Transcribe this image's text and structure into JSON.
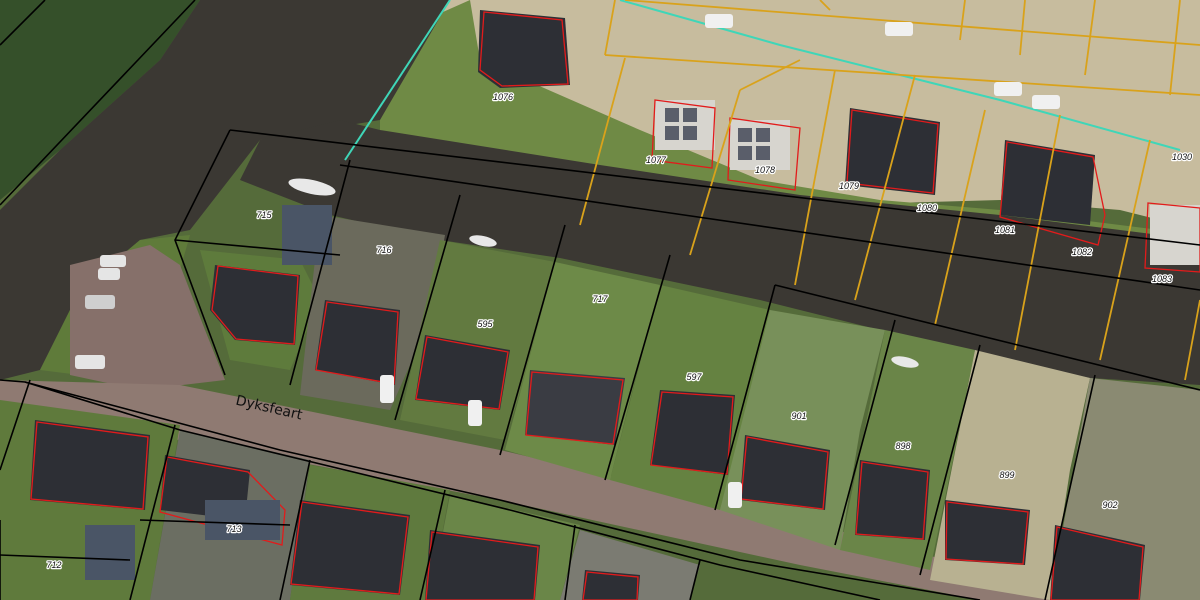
{
  "map": {
    "street_name": "Dyksfeart",
    "parcel_numbers": [
      "715",
      "716",
      "595",
      "717",
      "597",
      "901",
      "898",
      "899",
      "902",
      "712",
      "713",
      "1076",
      "1077",
      "1078",
      "1079",
      "1080",
      "1081",
      "1082",
      "1083",
      "1030"
    ],
    "colors": {
      "water": "#3b3833",
      "grass": "#4f6d34",
      "road": "#8f7a72",
      "sand": "#c9bd9f",
      "parcel_line": "#000000",
      "new_parcel_line": "#d9a21b",
      "building_outline": "#e21b1b",
      "cable_line": "#3fd6b8"
    }
  }
}
